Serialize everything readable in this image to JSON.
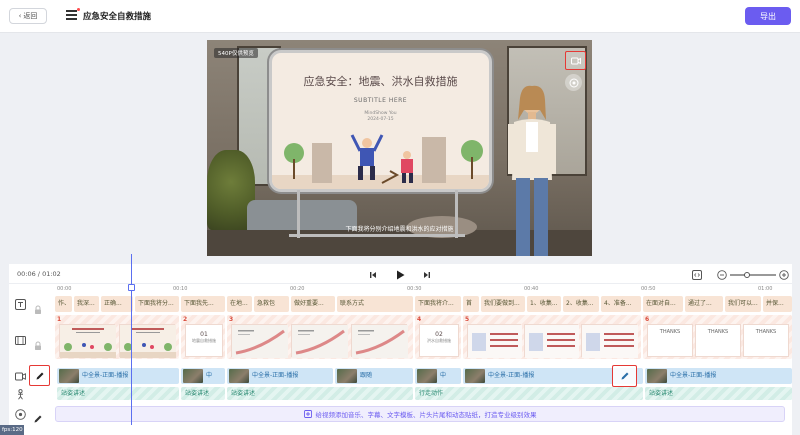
{
  "topbar": {
    "back_label": "返回",
    "doc_title": "应急安全自救措施",
    "export_label": "导出"
  },
  "preview": {
    "resolution_tag": "540P仅供预览",
    "board_title": "应急安全：地震、洪水自救措施",
    "board_subtitle": "SUBTITLE HERE",
    "board_author": "MindShow You",
    "board_date": "2024-07-15",
    "caption": "下面我将分别介绍地震和洪水的应对措施"
  },
  "timeline": {
    "current_time": "00:06",
    "total_time": "01:02",
    "ruler": [
      "00:00",
      "00:10",
      "00:20",
      "00:30",
      "00:40",
      "00:50",
      "01:00"
    ],
    "text_clips": [
      "作、",
      "我深...",
      "正确...",
      "下面我将分...",
      "下面我先...",
      "在地...",
      "急救包",
      "做好重要...",
      "联系方式",
      "下面我将介...",
      "首",
      "我们要做到...",
      "1、收集...",
      "2、收集...",
      "4、准备...",
      "在面对自...",
      "通过了...",
      "我们可以...",
      "并保..."
    ],
    "slide_numbers": [
      "1",
      "2",
      "3",
      "4",
      "5",
      "6"
    ],
    "slide2_label": "01",
    "slide2_sub": "地震自救措施",
    "slide4_label": "02",
    "slide4_sub": "洪水自救措施",
    "slide6_label": "THANKS",
    "avatar_clips": [
      "中全景-正面-播报",
      "中",
      "中全景-正面-播报",
      "跟随",
      "中",
      "中全景-正面-播报",
      "中全景-正面-播报"
    ],
    "motion_clips": [
      "站姿讲述",
      "站姿讲述",
      "站姿讲述",
      "行走动作",
      "站姿讲述"
    ],
    "add_hint": "给视频添加音乐、字幕、文字模板、片头片尾和动态贴纸，打造专业级别效果"
  },
  "status": {
    "fps": "fps:120"
  },
  "colors": {
    "accent": "#6b5cf0",
    "highlight": "#e53935",
    "playhead": "#5b6ff0"
  }
}
